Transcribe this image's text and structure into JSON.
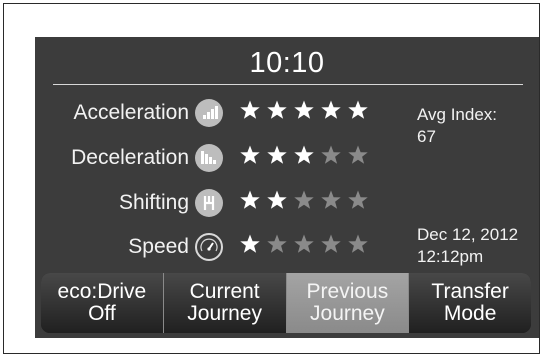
{
  "clock": "10:10",
  "metrics": [
    {
      "label": "Acceleration",
      "icon": "acceleration-icon",
      "stars_filled": 5,
      "stars_total": 5
    },
    {
      "label": "Deceleration",
      "icon": "deceleration-icon",
      "stars_filled": 3,
      "stars_total": 5
    },
    {
      "label": "Shifting",
      "icon": "gear-shift-icon",
      "stars_filled": 2,
      "stars_total": 5
    },
    {
      "label": "Speed",
      "icon": "speedometer-icon",
      "stars_filled": 1,
      "stars_total": 5
    }
  ],
  "avg_index": {
    "label": "Avg Index:",
    "value": "67"
  },
  "timestamp": {
    "date": "Dec 12, 2012",
    "time": "12:12pm"
  },
  "buttons": [
    {
      "line1": "eco:Drive",
      "line2": "Off",
      "selected": false
    },
    {
      "line1": "Current",
      "line2": "Journey",
      "selected": false
    },
    {
      "line1": "Previous",
      "line2": "Journey",
      "selected": true
    },
    {
      "line1": "Transfer",
      "line2": "Mode",
      "selected": false
    }
  ],
  "colors": {
    "screen_background": "#3c3c3c",
    "star_filled": "#ffffff",
    "star_empty": "#8a8a8a",
    "selected_button": "#9a9a9a"
  }
}
